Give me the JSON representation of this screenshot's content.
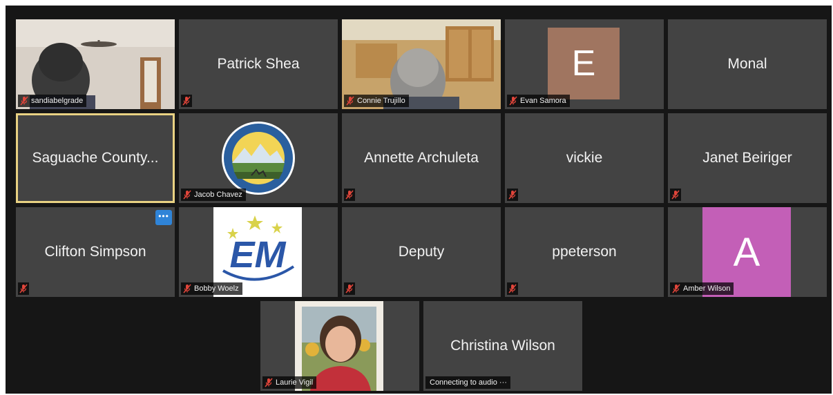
{
  "participants": [
    {
      "id": "sandiabelgrade",
      "label": "sandiabelgrade"
    },
    {
      "id": "patrick-shea",
      "name": "Patrick Shea"
    },
    {
      "id": "connie-trujillo",
      "label": "Connie Trujillo"
    },
    {
      "id": "evan-samora",
      "initial": "E",
      "label": "Evan Samora",
      "avatar_color": "#a07560"
    },
    {
      "id": "monal",
      "name": "Monal"
    },
    {
      "id": "saguache-county",
      "name": "Saguache County..."
    },
    {
      "id": "jacob-chavez",
      "label": "Jacob Chavez"
    },
    {
      "id": "annette-archuleta",
      "name": "Annette Archuleta"
    },
    {
      "id": "vickie",
      "name": "vickie"
    },
    {
      "id": "janet-beiriger",
      "name": "Janet Beiriger"
    },
    {
      "id": "clifton-simpson",
      "name": "Clifton Simpson",
      "more": "•••"
    },
    {
      "id": "bobby-woelz",
      "label": "Bobby Woelz",
      "logo_text": "EM"
    },
    {
      "id": "deputy",
      "name": "Deputy"
    },
    {
      "id": "ppeterson",
      "name": "ppeterson"
    },
    {
      "id": "amber-wilson",
      "initial": "A",
      "label": "Amber Wilson",
      "avatar_color": "#c35fb7"
    },
    {
      "id": "laurie-vigil",
      "label": "Laurie Vigil"
    },
    {
      "id": "christina-wilson",
      "name": "Christina Wilson",
      "status": "Connecting to audio ···"
    }
  ],
  "colors": {
    "tile_bg": "#434343",
    "gallery_bg": "#161616",
    "active_border": "#e9d283",
    "muted_mic": "#e0453a"
  },
  "icons": {
    "mic": "microphone-muted-icon",
    "more": "more-options-icon"
  }
}
